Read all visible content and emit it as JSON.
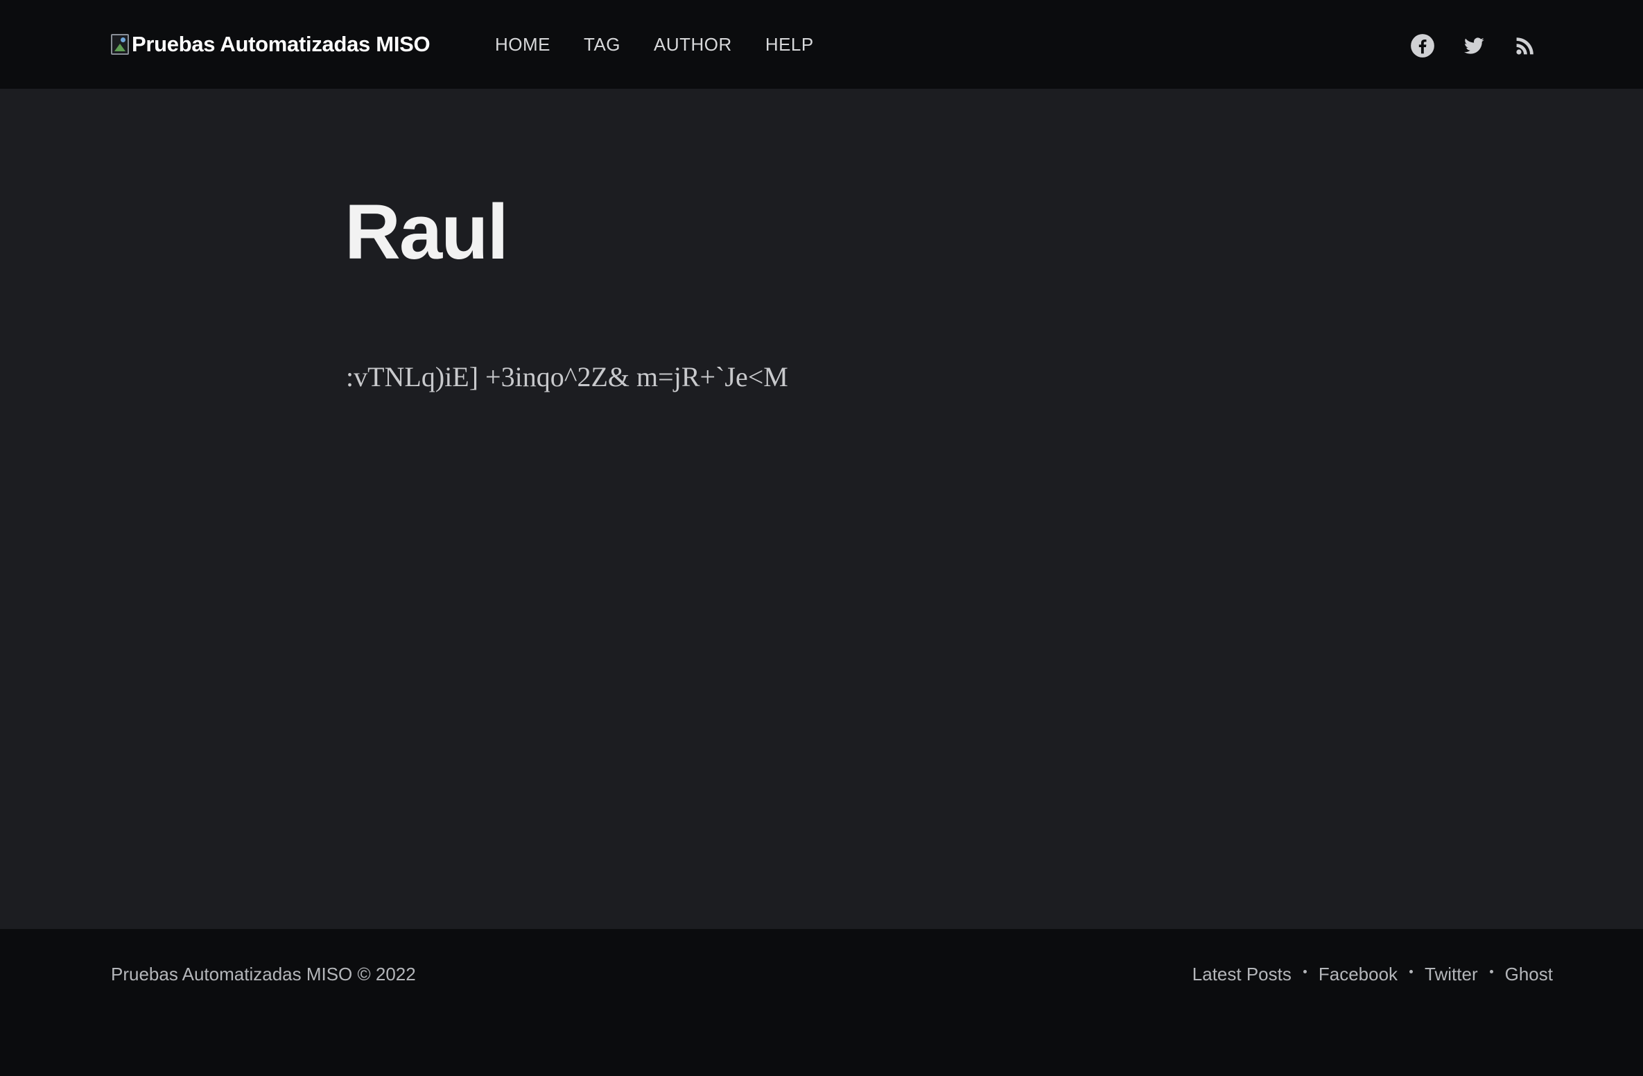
{
  "header": {
    "site_title": "Pruebas Automatizadas MISO",
    "nav": [
      {
        "label": "HOME"
      },
      {
        "label": "TAG"
      },
      {
        "label": "AUTHOR"
      },
      {
        "label": "HELP"
      }
    ],
    "social_icons": [
      "facebook-icon",
      "twitter-icon",
      "rss-icon"
    ]
  },
  "main": {
    "author_name": "Raul",
    "author_bio": ":vTNLq)iE] +3inqo^2Z& m=jR+`Je<M"
  },
  "footer": {
    "copyright": "Pruebas Automatizadas MISO © 2022",
    "links": [
      {
        "label": "Latest Posts"
      },
      {
        "label": "Facebook"
      },
      {
        "label": "Twitter"
      },
      {
        "label": "Ghost"
      }
    ]
  },
  "colors": {
    "header_bg": "#0b0c0e",
    "page_bg": "#1c1d21",
    "footer_bg": "#0b0c0e",
    "heading_text": "#f2f2f2",
    "body_text": "#c8c9cc"
  }
}
